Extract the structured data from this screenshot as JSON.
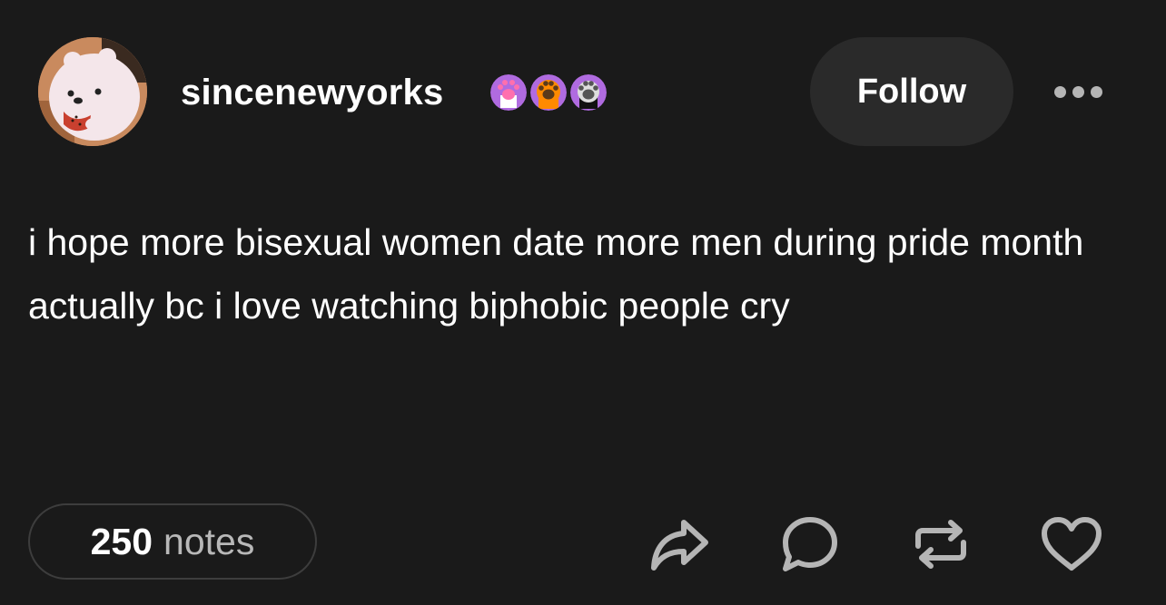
{
  "post": {
    "username": "sincenewyorks",
    "follow_label": "Follow",
    "body_text": "i hope more bisexual women date more men during pride month actually bc i love watching biphobic people cry",
    "notes_count": "250",
    "notes_label": "notes"
  },
  "badges": [
    {
      "name": "paw-badge-pink",
      "colors": {
        "bg": "#b06be0",
        "pad": "#ff6fae",
        "base": "#ffffff"
      }
    },
    {
      "name": "paw-badge-orange",
      "colors": {
        "bg": "#b06be0",
        "pad": "#5a3a1a",
        "base": "#ff8a00"
      }
    },
    {
      "name": "paw-badge-black",
      "colors": {
        "bg": "#b06be0",
        "pad": "#555555",
        "base": "#111111"
      }
    }
  ],
  "icons": [
    "share-icon",
    "reply-icon",
    "reblog-icon",
    "like-icon",
    "more-options-icon"
  ],
  "colors": {
    "background": "#1a1a1a",
    "follow_button_bg": "#2a2a2a",
    "icon_gray": "#b5b5b5",
    "notes_border": "#3d3d3d"
  }
}
